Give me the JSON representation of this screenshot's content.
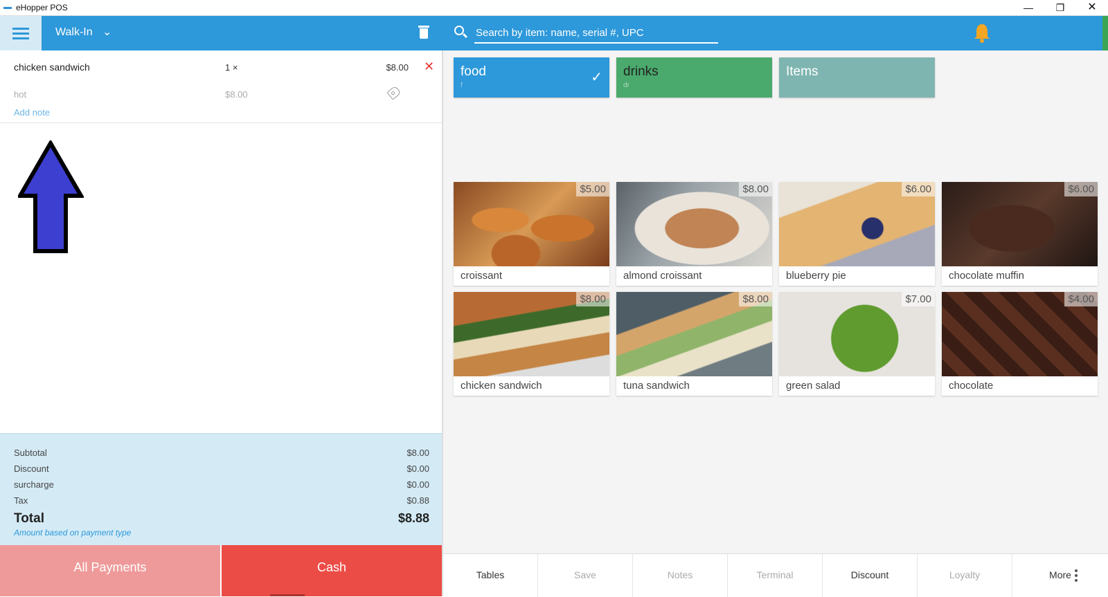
{
  "window": {
    "title": "eHopper POS",
    "minimize": "—",
    "maximize": "❐",
    "close": "✕"
  },
  "order": {
    "customer": "Walk-In",
    "item": {
      "name": "chicken sandwich",
      "qty": "1 ×",
      "price": "$8.00",
      "modifier": "hot",
      "modifier_price": "$8.00",
      "add_note": "Add note"
    }
  },
  "totals": {
    "subtotal_label": "Subtotal",
    "subtotal": "$8.00",
    "discount_label": "Discount",
    "discount": "$0.00",
    "surcharge_label": "surcharge",
    "surcharge": "$0.00",
    "tax_label": "Tax",
    "tax": "$0.88",
    "total_label": "Total",
    "total": "$8.88",
    "note": "Amount based on payment type"
  },
  "payments": {
    "all": "All Payments",
    "cash": "Cash"
  },
  "search": {
    "placeholder": "Search by item: name, serial #, UPC"
  },
  "categories": [
    {
      "name": "food",
      "code": "f",
      "selected": true,
      "color": "#2d98da"
    },
    {
      "name": "drinks",
      "code": "dr",
      "selected": false,
      "color": "#4aa96c"
    },
    {
      "name": "Items",
      "code": "",
      "selected": false,
      "color": "#7fb5b0"
    }
  ],
  "products": [
    {
      "name": "croissant",
      "price": "$5.00"
    },
    {
      "name": "almond croissant",
      "price": "$8.00"
    },
    {
      "name": "blueberry pie",
      "price": "$6.00"
    },
    {
      "name": "chocolate muffin",
      "price": "$6.00"
    },
    {
      "name": "chicken sandwich",
      "price": "$8.00"
    },
    {
      "name": "tuna sandwich",
      "price": "$8.00"
    },
    {
      "name": "green salad",
      "price": "$7.00"
    },
    {
      "name": "chocolate",
      "price": "$4.00"
    }
  ],
  "bottom": {
    "tables": "Tables",
    "save": "Save",
    "notes": "Notes",
    "terminal": "Terminal",
    "discount": "Discount",
    "loyalty": "Loyalty",
    "more": "More"
  },
  "colors": {
    "primary": "#2d98da",
    "cash": "#ec4c46",
    "all_payments": "#ef9a9a",
    "bell": "#f5a623",
    "totals_bg": "#d4ebf6"
  }
}
